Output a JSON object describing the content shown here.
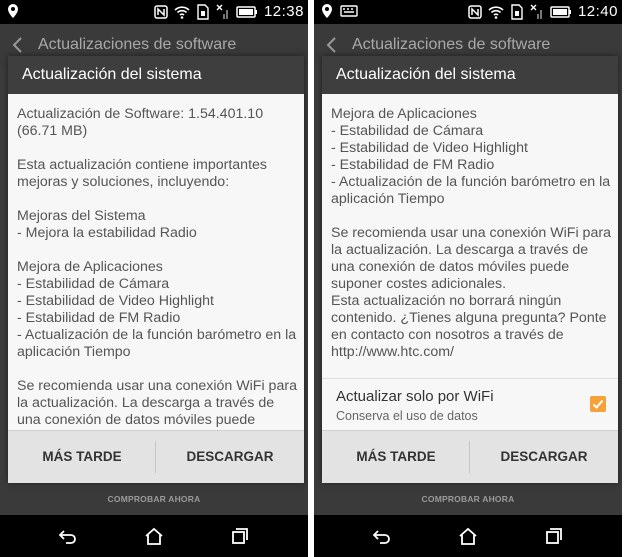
{
  "screens": [
    {
      "status_time": "12:38",
      "action_bar_title": "Actualizaciones de software",
      "dialog": {
        "title": "Actualización del sistema",
        "paragraphs": [
          "Actualización de Software: 1.54.401.10 (66.71 MB)",
          "Esta actualización contiene importantes mejoras y soluciones, incluyendo:",
          "Mejoras del Sistema\n- Mejora la estabilidad Radio",
          "Mejora de Aplicaciones\n- Estabilidad de Cámara\n- Estabilidad de Video Highlight\n- Estabilidad de FM Radio\n- Actualización de la función barómetro en la aplicación Tiempo",
          "Se recomienda usar una conexión WiFi para la actualización. La descarga a través de una conexión de datos móviles puede"
        ],
        "later_button": "MÁS TARDE",
        "download_button": "DESCARGAR"
      },
      "check_now": "COMPROBAR AHORA"
    },
    {
      "status_time": "12:40",
      "action_bar_title": "Actualizaciones de software",
      "dialog": {
        "title": "Actualización del sistema",
        "paragraphs": [
          "Mejora de Aplicaciones\n- Estabilidad de Cámara\n- Estabilidad de Video Highlight\n- Estabilidad de FM Radio\n- Actualización de la función barómetro en la aplicación Tiempo",
          "Se recomienda usar una conexión WiFi para la actualización. La descarga a través de una conexión de datos móviles puede suponer costes adicionales.",
          "Esta actualización no borrará ningún contenido. ¿Tienes alguna pregunta? Ponte en contacto con nosotros a través de http://www.htc.com/"
        ],
        "wifi_option": {
          "label": "Actualizar solo por WiFi",
          "sublabel": "Conserva el uso de datos",
          "checked": true
        },
        "later_button": "MÁS TARDE",
        "download_button": "DESCARGAR"
      },
      "check_now": "COMPROBAR AHORA"
    }
  ],
  "colors": {
    "checkbox_accent": "#f7a13a",
    "dialog_header": "#3e3e3e",
    "status_bar": "#000000"
  },
  "icons": {
    "status_left": [
      "location-icon",
      "keyboard-icon"
    ],
    "status_right": [
      "nfc-icon",
      "wifi-icon",
      "sim-icon",
      "signal-off-icon",
      "battery-icon"
    ],
    "nav": [
      "back-icon",
      "home-icon",
      "recent-apps-icon"
    ]
  }
}
